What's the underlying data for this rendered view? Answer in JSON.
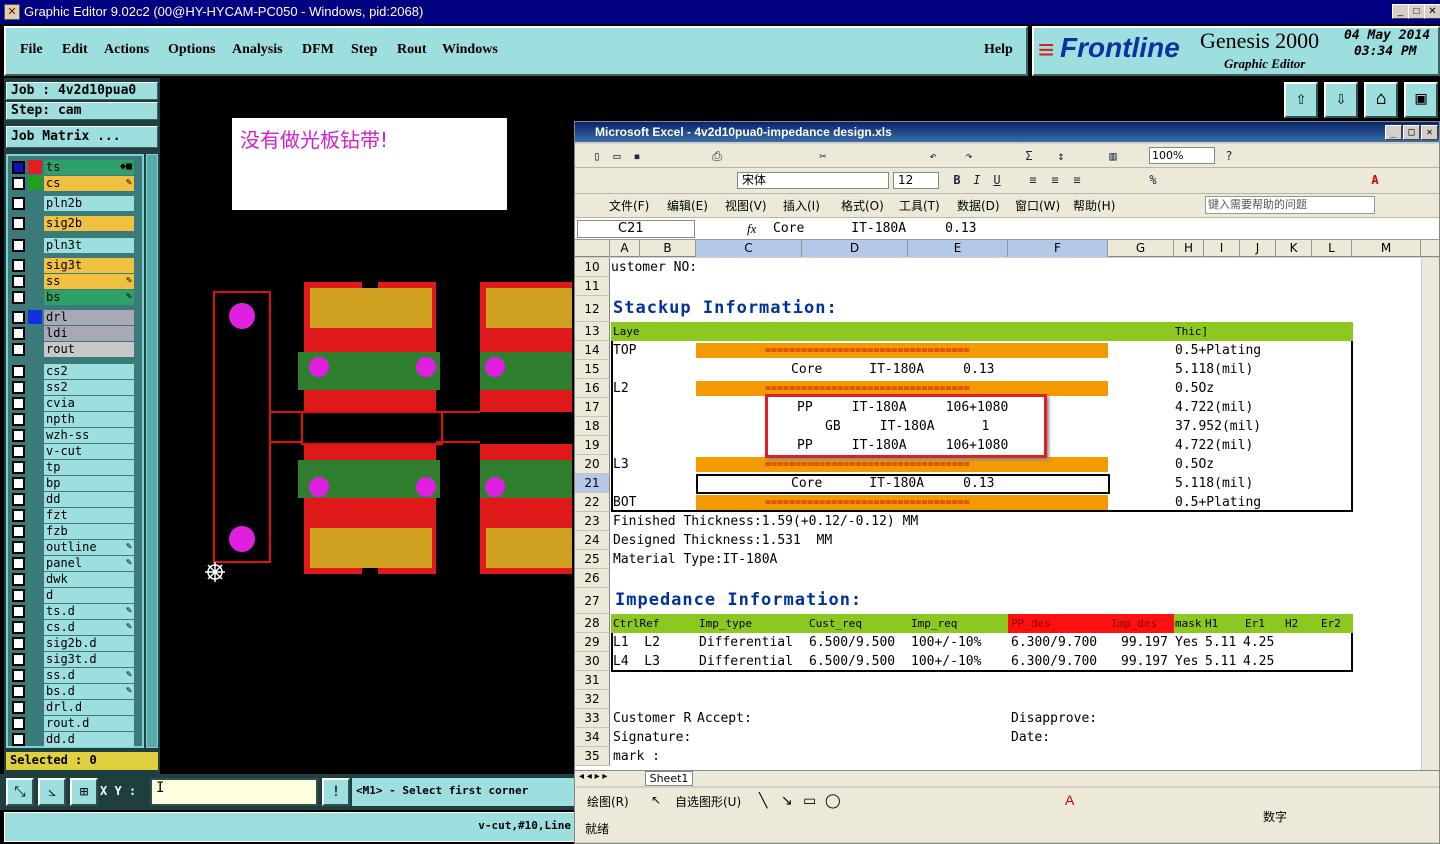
{
  "genesis": {
    "title": "Graphic Editor 9.02c2 (00@HY-HYCAM-PC050 - Windows, pid:2068)",
    "menu": [
      "File",
      "Edit",
      "Actions",
      "Options",
      "Analysis",
      "DFM",
      "Step",
      "Rout",
      "Windows"
    ],
    "help": "Help",
    "brand": "Frontline",
    "product": "Genesis 2000",
    "subtitle": "Graphic Editor",
    "date": "04 May 2014",
    "time": "03:34 PM",
    "job": "Job : 4v2d10pua0",
    "step": "Step: cam",
    "job_matrix": "Job Matrix ...",
    "layers": [
      {
        "name": "ts",
        "color": "#2fa06a",
        "flag": "◆■",
        "sw": "#e02020",
        "sw0": "#1010c0"
      },
      {
        "name": "cs",
        "color": "#f0c040",
        "flag": "✎",
        "sw": "#20a020"
      },
      {
        "name": "pln2b",
        "color": "#9ddede",
        "flag": ""
      },
      {
        "name": "sig2b",
        "color": "#f0c040",
        "flag": ""
      },
      {
        "name": "pln3t",
        "color": "#9ddede",
        "flag": ""
      },
      {
        "name": "sig3t",
        "color": "#f0c040",
        "flag": ""
      },
      {
        "name": "ss",
        "color": "#f0c040",
        "flag": "✎"
      },
      {
        "name": "bs",
        "color": "#2fa06a",
        "flag": "✎"
      },
      {
        "name": "drl",
        "color": "#a8a8b8",
        "flag": "",
        "sw": "#1030e0"
      },
      {
        "name": "ldi",
        "color": "#a8a8b8",
        "flag": ""
      },
      {
        "name": "rout",
        "color": "#c8c8c8",
        "flag": ""
      },
      {
        "name": "cs2",
        "color": "#9ddede",
        "flag": ""
      },
      {
        "name": "ss2",
        "color": "#9ddede",
        "flag": ""
      },
      {
        "name": "cvia",
        "color": "#9ddede",
        "flag": ""
      },
      {
        "name": "npth",
        "color": "#9ddede",
        "flag": ""
      },
      {
        "name": "wzh-ss",
        "color": "#9ddede",
        "flag": ""
      },
      {
        "name": "v-cut",
        "color": "#9ddede",
        "flag": ""
      },
      {
        "name": "tp",
        "color": "#9ddede",
        "flag": ""
      },
      {
        "name": "bp",
        "color": "#9ddede",
        "flag": ""
      },
      {
        "name": "dd",
        "color": "#9ddede",
        "flag": ""
      },
      {
        "name": "fzt",
        "color": "#9ddede",
        "flag": ""
      },
      {
        "name": "fzb",
        "color": "#9ddede",
        "flag": ""
      },
      {
        "name": "outline",
        "color": "#9ddede",
        "flag": "✎"
      },
      {
        "name": "panel",
        "color": "#9ddede",
        "flag": "✎"
      },
      {
        "name": "dwk",
        "color": "#9ddede",
        "flag": ""
      },
      {
        "name": "d",
        "color": "#9ddede",
        "flag": ""
      },
      {
        "name": "ts.d",
        "color": "#9ddede",
        "flag": "✎"
      },
      {
        "name": "cs.d",
        "color": "#9ddede",
        "flag": "✎"
      },
      {
        "name": "sig2b.d",
        "color": "#9ddede",
        "flag": ""
      },
      {
        "name": "sig3t.d",
        "color": "#9ddede",
        "flag": ""
      },
      {
        "name": "ss.d",
        "color": "#9ddede",
        "flag": "✎"
      },
      {
        "name": "bs.d",
        "color": "#9ddede",
        "flag": "✎"
      },
      {
        "name": "drl.d",
        "color": "#9ddede",
        "flag": ""
      },
      {
        "name": "rout.d",
        "color": "#9ddede",
        "flag": ""
      },
      {
        "name": "dd.d",
        "color": "#9ddede",
        "flag": ""
      }
    ],
    "selected": "Selected : 0",
    "note": "没有做光板钻带!",
    "xy_label": "X Y :",
    "xy_value": "I",
    "prompt": "<M1> - Select first corner",
    "status": "v-cut,#10,Line"
  },
  "excel": {
    "title": "Microsoft Excel - 4v2d10pua0-impedance design.xls",
    "font": "宋体",
    "size": "12",
    "zoom": "100%",
    "menu": [
      "文件(F)",
      "编辑(E)",
      "视图(V)",
      "插入(I)",
      "格式(O)",
      "工具(T)",
      "数据(D)",
      "窗口(W)",
      "帮助(H)"
    ],
    "help_search": "键入需要帮助的问题",
    "namebox": "C21",
    "formula": "Core      IT-180A     0.13",
    "columns": [
      "A",
      "B",
      "C",
      "D",
      "E",
      "F",
      "G",
      "H",
      "I",
      "J",
      "K",
      "L",
      "M"
    ],
    "rows": {
      "r10": "ustomer NO:",
      "r12": "Stackup Information:",
      "r13a": "Laye",
      "r13b": "Thic]",
      "r14a": "TOP",
      "r14b": "0.5+Plating",
      "r15a": "Core      IT-180A     0.13",
      "r15b": "5.118(mil)",
      "r16a": "L2",
      "r16b": "0.5Oz",
      "r17a": "PP     IT-180A     106+1080",
      "r17b": "4.722(mil)",
      "r18a": "GB     IT-180A      1",
      "r18b": "37.952(mil)",
      "r19a": "PP     IT-180A     106+1080",
      "r19b": "4.722(mil)",
      "r20a": "L3",
      "r20b": "0.5Oz",
      "r21a": "Core      IT-180A     0.13",
      "r21b": "5.118(mil)",
      "r22a": "BOT",
      "r22b": "0.5+Plating",
      "r23": "Finished Thickness:1.59(+0.12/-0.12) MM",
      "r24": "Designed Thickness:1.531  MM",
      "r25": "Material Type:IT-180A",
      "r27": "Impedance Information:",
      "imp_headers": [
        "CtrlRef",
        "Imp_type",
        "Cust_req",
        "Imp_req",
        "PP_des",
        "Imp_des",
        "mask",
        "H1",
        "Er1",
        "H2",
        "Er2"
      ],
      "imp_rows": [
        [
          "L1  L2",
          "Differential",
          "6.500/9.500",
          "100+/-10%",
          "6.300/9.700",
          "99.197",
          "Yes",
          "5.11",
          "4.25"
        ],
        [
          "L4  L3",
          "Differential",
          "6.500/9.500",
          "100+/-10%",
          "6.300/9.700",
          "99.197",
          "Yes",
          "5.11",
          "4.25"
        ]
      ],
      "r33a": "Customer R",
      "r33b": "Accept:",
      "r33c": "Disapprove:",
      "r34a": "Signature:",
      "r34b": "Date:",
      "r35": "mark :"
    },
    "sheet_tab": "Sheet1",
    "draw_label": "绘图(R)",
    "autoshape": "自选图形(U)",
    "status_ready": "就绪",
    "status_num": "数字"
  }
}
